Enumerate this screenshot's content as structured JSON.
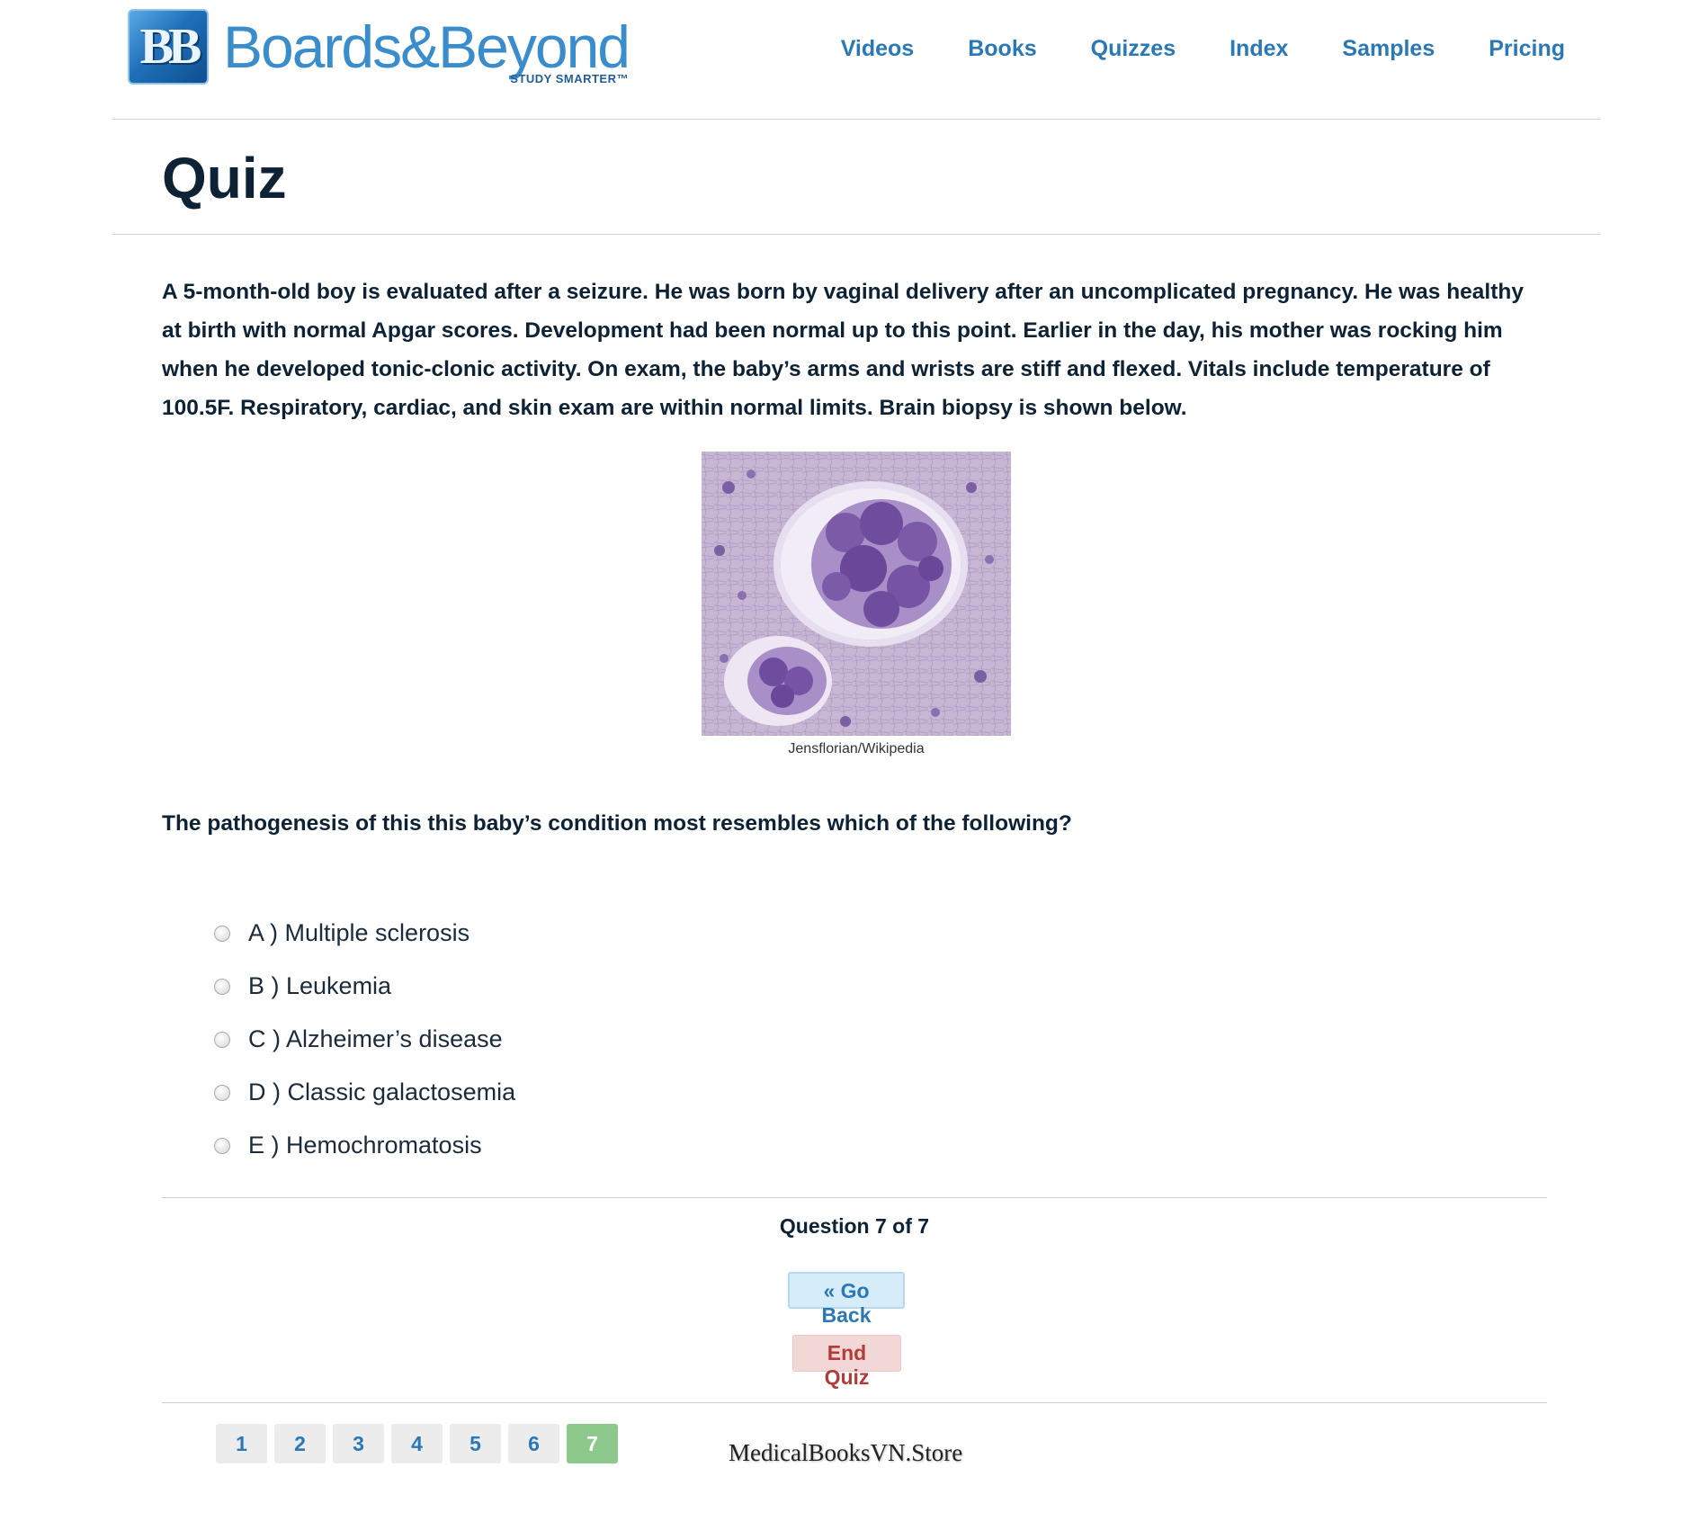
{
  "brand": {
    "mark": "BB",
    "name": "Boards&Beyond",
    "tagline": "STUDY SMARTER™"
  },
  "nav": {
    "items": [
      {
        "label": "Videos"
      },
      {
        "label": "Books"
      },
      {
        "label": "Quizzes"
      },
      {
        "label": "Index"
      },
      {
        "label": "Samples"
      },
      {
        "label": "Pricing"
      }
    ]
  },
  "page": {
    "title": "Quiz"
  },
  "question": {
    "stem": "A 5-month-old boy is evaluated after a seizure. He was born by vaginal delivery after an uncomplicated pregnancy. He was healthy at birth with normal Apgar scores. Development had been normal up to this point. Earlier in the day, his mother was rocking him when he developed tonic-clonic activity. On exam, the baby’s arms and wrists are stiff and flexed. Vitals include temperature of 100.5F. Respiratory, cardiac, and skin exam are within normal limits. Brain biopsy is shown below.",
    "image_credit": "Jensflorian/Wikipedia",
    "prompt": "The pathogenesis of this this baby’s condition most resembles which of the following?",
    "options": [
      {
        "label": "A ) Multiple sclerosis"
      },
      {
        "label": "B ) Leukemia"
      },
      {
        "label": "C ) Alzheimer’s disease"
      },
      {
        "label": "D ) Classic galactosemia"
      },
      {
        "label": "E ) Hemochromatosis"
      }
    ]
  },
  "footer": {
    "progress": "Question 7 of 7",
    "back_label": "« Go Back",
    "end_label": "End Quiz",
    "pages": [
      "1",
      "2",
      "3",
      "4",
      "5",
      "6",
      "7"
    ],
    "current_page": "7",
    "watermark": "MedicalBooksVN.Store"
  },
  "colors": {
    "accent": "#2a79b6",
    "heading": "#0d2235",
    "end_button": "#b33b3b",
    "active_page": "#8ec98c"
  }
}
